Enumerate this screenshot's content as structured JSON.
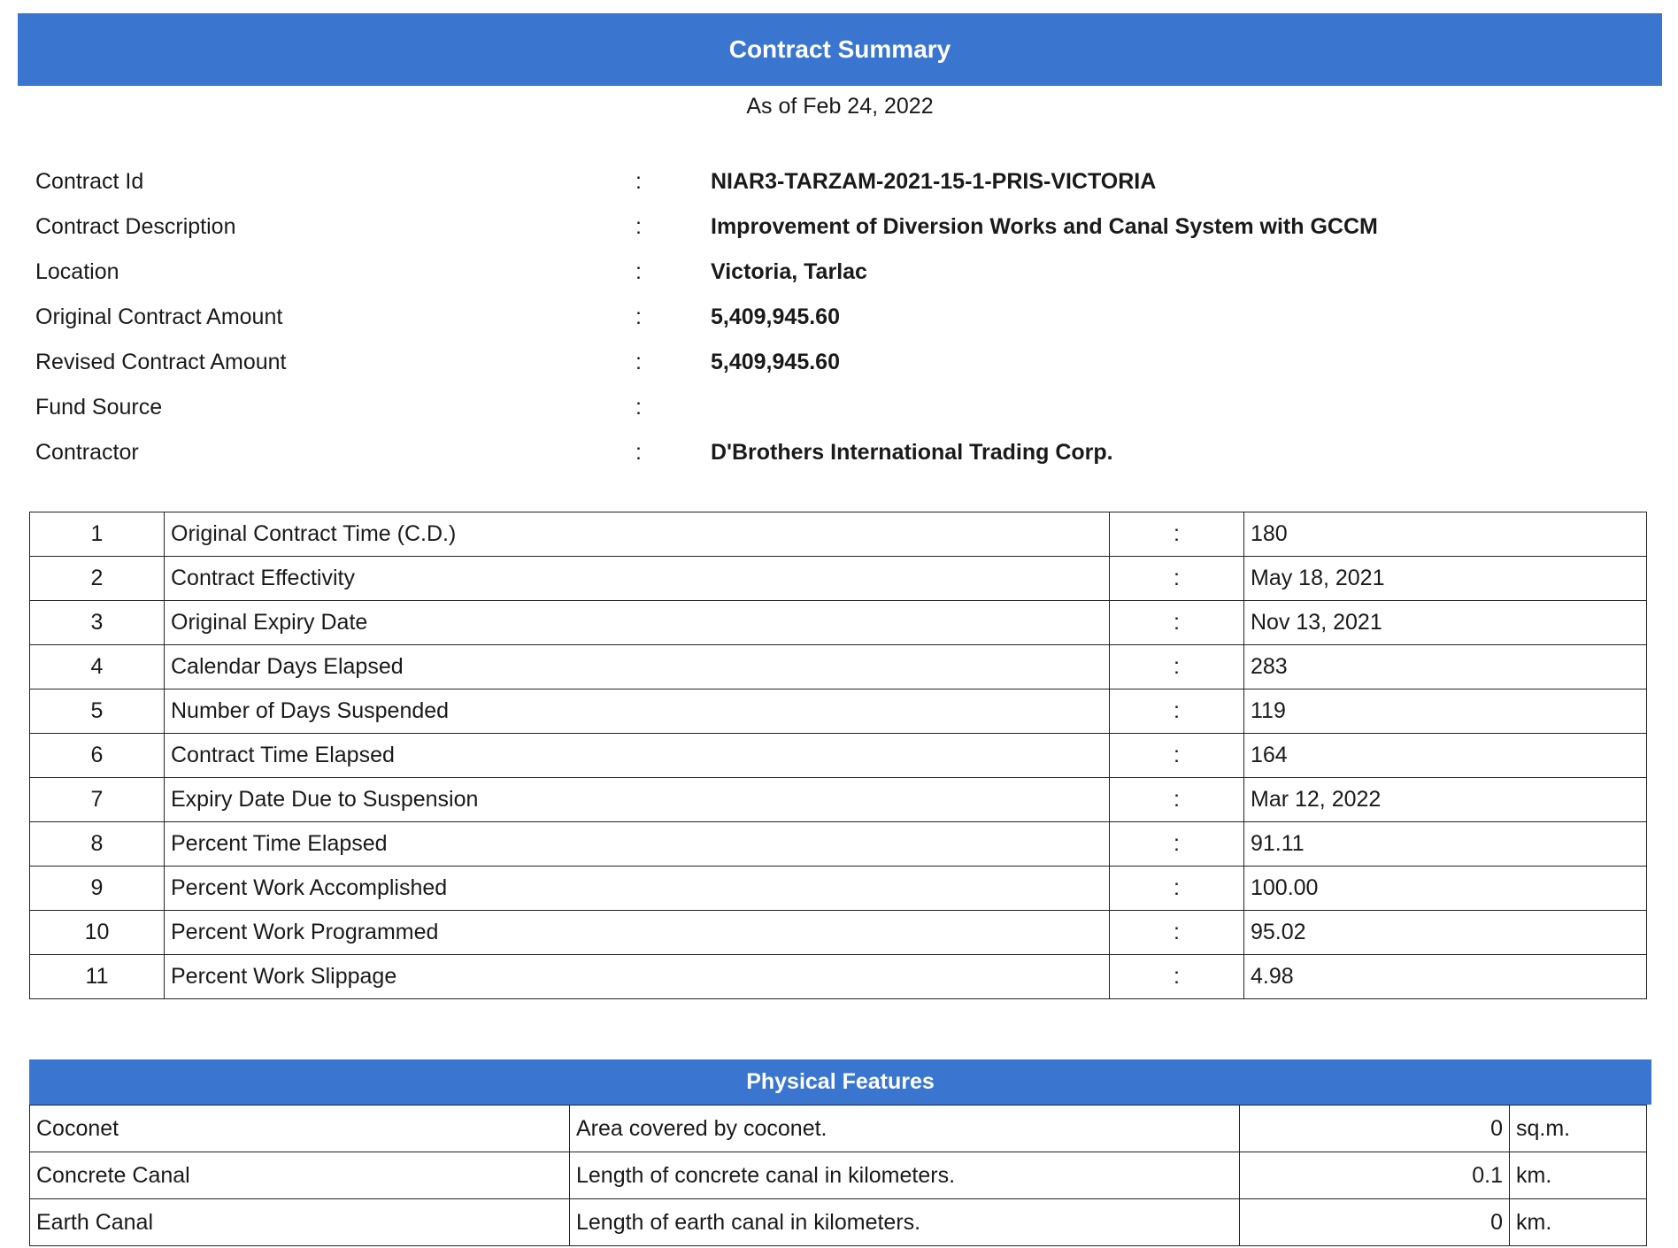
{
  "header": {
    "title": "Contract Summary",
    "as_of": "As of Feb 24, 2022"
  },
  "info": [
    {
      "label": "Contract Id",
      "colon": ":",
      "value": "NIAR3-TARZAM-2021-15-1-PRIS-VICTORIA"
    },
    {
      "label": "Contract Description",
      "colon": ":",
      "value": "Improvement of Diversion Works and Canal System with GCCM"
    },
    {
      "label": "Location",
      "colon": ":",
      "value": "Victoria, Tarlac"
    },
    {
      "label": "Original Contract Amount",
      "colon": ":",
      "value": "5,409,945.60"
    },
    {
      "label": "Revised Contract Amount",
      "colon": ":",
      "value": "5,409,945.60"
    },
    {
      "label": "Fund Source",
      "colon": ":",
      "value": ""
    },
    {
      "label": "Contractor",
      "colon": ":",
      "value": "D'Brothers International Trading Corp."
    }
  ],
  "stats": [
    {
      "no": "1",
      "label": "Original Contract Time (C.D.)",
      "colon": ":",
      "value": "180"
    },
    {
      "no": "2",
      "label": "Contract Effectivity",
      "colon": ":",
      "value": "May 18, 2021"
    },
    {
      "no": "3",
      "label": "Original Expiry Date",
      "colon": ":",
      "value": "Nov 13, 2021"
    },
    {
      "no": "4",
      "label": "Calendar Days Elapsed",
      "colon": ":",
      "value": "283"
    },
    {
      "no": "5",
      "label": "Number of Days Suspended",
      "colon": ":",
      "value": "119"
    },
    {
      "no": "6",
      "label": "Contract Time Elapsed",
      "colon": ":",
      "value": "164"
    },
    {
      "no": "7",
      "label": "Expiry Date Due to Suspension",
      "colon": ":",
      "value": "Mar 12, 2022"
    },
    {
      "no": "8",
      "label": "Percent Time Elapsed",
      "colon": ":",
      "value": "91.11"
    },
    {
      "no": "9",
      "label": "Percent Work Accomplished",
      "colon": ":",
      "value": "100.00"
    },
    {
      "no": "10",
      "label": "Percent Work Programmed",
      "colon": ":",
      "value": "95.02"
    },
    {
      "no": "11",
      "label": "Percent Work Slippage",
      "colon": ":",
      "value": "4.98"
    }
  ],
  "physical_features": {
    "title": "Physical Features",
    "rows": [
      {
        "name": "Coconet",
        "desc": "Area covered by coconet.",
        "qty": "0",
        "unit": "sq.m."
      },
      {
        "name": "Concrete Canal",
        "desc": "Length of concrete canal in kilometers.",
        "qty": "0.1",
        "unit": "km."
      },
      {
        "name": "Earth Canal",
        "desc": "Length of earth canal in kilometers.",
        "qty": "0",
        "unit": "km."
      }
    ]
  }
}
